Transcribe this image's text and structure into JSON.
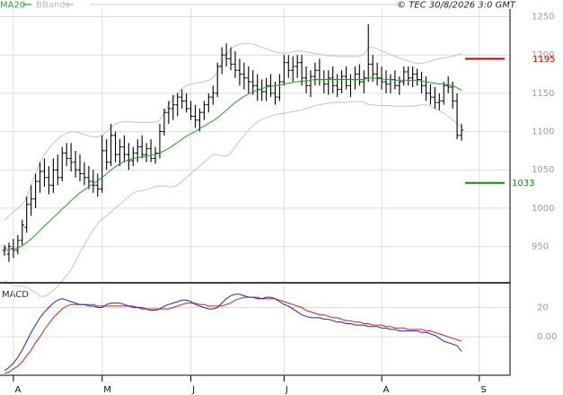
{
  "chart_data": [
    {
      "type": "ohlc",
      "legend": [
        {
          "name": "MA20",
          "color": "#2aa52a"
        },
        {
          "name": "BBands",
          "color": "#b8b8b8"
        }
      ],
      "copyright": "© TEC 30/8/2026 3:0 GMT",
      "ylim": [
        905,
        1260
      ],
      "y_ticks": [
        950,
        1000,
        1050,
        1100,
        1150,
        1200,
        1250
      ],
      "y_tick_labels": [
        "950",
        "1000",
        "1050",
        "1100",
        "1150",
        "1200",
        "1250"
      ],
      "x_ticks": [
        {
          "label": "A",
          "index": 1
        },
        {
          "label": "M",
          "index": 21
        },
        {
          "label": "J",
          "index": 41
        },
        {
          "label": "J",
          "index": 62
        },
        {
          "label": "A",
          "index": 84
        },
        {
          "label": "S",
          "index": 106
        }
      ],
      "levels": [
        {
          "label": "1195",
          "value": 1195,
          "color": "#cc0000"
        },
        {
          "label": "1033",
          "value": 1033,
          "color": "#118811"
        }
      ],
      "price_ohlc": [
        [
          945,
          952,
          938,
          948
        ],
        [
          940,
          955,
          930,
          950
        ],
        [
          948,
          960,
          935,
          945
        ],
        [
          945,
          965,
          940,
          958
        ],
        [
          958,
          985,
          952,
          978
        ],
        [
          975,
          1015,
          968,
          1005
        ],
        [
          1005,
          1030,
          990,
          1012
        ],
        [
          1012,
          1045,
          1000,
          1035
        ],
        [
          1035,
          1060,
          1020,
          1048
        ],
        [
          1048,
          1065,
          1028,
          1040
        ],
        [
          1040,
          1055,
          1018,
          1030
        ],
        [
          1030,
          1065,
          1020,
          1050
        ],
        [
          1050,
          1070,
          1030,
          1040
        ],
        [
          1040,
          1080,
          1035,
          1072
        ],
        [
          1072,
          1085,
          1055,
          1065
        ],
        [
          1065,
          1085,
          1048,
          1060
        ],
        [
          1060,
          1075,
          1040,
          1050
        ],
        [
          1050,
          1070,
          1035,
          1045
        ],
        [
          1045,
          1060,
          1030,
          1040
        ],
        [
          1040,
          1055,
          1025,
          1035
        ],
        [
          1035,
          1050,
          1020,
          1030
        ],
        [
          1030,
          1045,
          1015,
          1025
        ],
        [
          1025,
          1095,
          1020,
          1075
        ],
        [
          1075,
          1090,
          1050,
          1060
        ],
        [
          1060,
          1110,
          1055,
          1095
        ],
        [
          1095,
          1100,
          1060,
          1070
        ],
        [
          1070,
          1090,
          1055,
          1080
        ],
        [
          1080,
          1095,
          1060,
          1070
        ],
        [
          1070,
          1085,
          1050,
          1062
        ],
        [
          1062,
          1080,
          1055,
          1072
        ],
        [
          1072,
          1090,
          1060,
          1080
        ],
        [
          1080,
          1095,
          1065,
          1070
        ],
        [
          1070,
          1085,
          1060,
          1078
        ],
        [
          1078,
          1090,
          1060,
          1065
        ],
        [
          1065,
          1080,
          1058,
          1072
        ],
        [
          1072,
          1110,
          1065,
          1100
        ],
        [
          1100,
          1130,
          1095,
          1125
        ],
        [
          1125,
          1140,
          1110,
          1130
        ],
        [
          1130,
          1148,
          1115,
          1135
        ],
        [
          1135,
          1150,
          1120,
          1145
        ],
        [
          1145,
          1155,
          1130,
          1140
        ],
        [
          1140,
          1150,
          1125,
          1130
        ],
        [
          1130,
          1140,
          1115,
          1120
        ],
        [
          1120,
          1135,
          1105,
          1115
        ],
        [
          1115,
          1130,
          1100,
          1125
        ],
        [
          1125,
          1140,
          1115,
          1135
        ],
        [
          1135,
          1150,
          1125,
          1145
        ],
        [
          1145,
          1160,
          1135,
          1150
        ],
        [
          1150,
          1190,
          1145,
          1185
        ],
        [
          1185,
          1210,
          1175,
          1200
        ],
        [
          1200,
          1215,
          1185,
          1195
        ],
        [
          1195,
          1210,
          1180,
          1188
        ],
        [
          1188,
          1205,
          1170,
          1180
        ],
        [
          1180,
          1195,
          1160,
          1175
        ],
        [
          1175,
          1190,
          1155,
          1170
        ],
        [
          1170,
          1185,
          1150,
          1165
        ],
        [
          1165,
          1180,
          1148,
          1160
        ],
        [
          1160,
          1175,
          1140,
          1155
        ],
        [
          1155,
          1168,
          1140,
          1152
        ],
        [
          1152,
          1170,
          1140,
          1160
        ],
        [
          1160,
          1175,
          1145,
          1150
        ],
        [
          1150,
          1165,
          1135,
          1145
        ],
        [
          1145,
          1175,
          1140,
          1165
        ],
        [
          1165,
          1200,
          1160,
          1190
        ],
        [
          1190,
          1200,
          1170,
          1180
        ],
        [
          1180,
          1198,
          1165,
          1185
        ],
        [
          1185,
          1200,
          1170,
          1190
        ],
        [
          1190,
          1200,
          1160,
          1170
        ],
        [
          1170,
          1185,
          1150,
          1160
        ],
        [
          1160,
          1180,
          1145,
          1172
        ],
        [
          1172,
          1190,
          1160,
          1180
        ],
        [
          1180,
          1195,
          1160,
          1168
        ],
        [
          1168,
          1180,
          1150,
          1162
        ],
        [
          1162,
          1180,
          1148,
          1170
        ],
        [
          1170,
          1185,
          1150,
          1160
        ],
        [
          1160,
          1175,
          1145,
          1155
        ],
        [
          1155,
          1180,
          1150,
          1172
        ],
        [
          1172,
          1185,
          1155,
          1160
        ],
        [
          1160,
          1175,
          1145,
          1168
        ],
        [
          1168,
          1185,
          1155,
          1175
        ],
        [
          1175,
          1188,
          1160,
          1165
        ],
        [
          1165,
          1180,
          1150,
          1170
        ],
        [
          1170,
          1240,
          1165,
          1188
        ],
        [
          1188,
          1200,
          1165,
          1175
        ],
        [
          1175,
          1190,
          1160,
          1170
        ],
        [
          1170,
          1185,
          1155,
          1165
        ],
        [
          1165,
          1180,
          1150,
          1162
        ],
        [
          1162,
          1175,
          1150,
          1168
        ],
        [
          1168,
          1180,
          1155,
          1160
        ],
        [
          1160,
          1172,
          1148,
          1165
        ],
        [
          1165,
          1185,
          1160,
          1178
        ],
        [
          1178,
          1185,
          1160,
          1170
        ],
        [
          1170,
          1185,
          1158,
          1175
        ],
        [
          1175,
          1182,
          1160,
          1168
        ],
        [
          1168,
          1178,
          1150,
          1160
        ],
        [
          1160,
          1172,
          1140,
          1150
        ],
        [
          1150,
          1162,
          1135,
          1145
        ],
        [
          1145,
          1158,
          1130,
          1138
        ],
        [
          1138,
          1150,
          1128,
          1140
        ],
        [
          1140,
          1165,
          1135,
          1160
        ],
        [
          1160,
          1172,
          1150,
          1158
        ],
        [
          1158,
          1165,
          1130,
          1140
        ],
        [
          1140,
          1150,
          1090,
          1095
        ],
        [
          1095,
          1110,
          1088,
          1102
        ]
      ],
      "ma20": [
        945,
        946,
        947,
        948,
        951,
        955,
        960,
        965,
        971,
        977,
        982,
        988,
        993,
        999,
        1004,
        1010,
        1015,
        1020,
        1024,
        1028,
        1032,
        1036,
        1040,
        1045,
        1050,
        1054,
        1058,
        1061,
        1063,
        1065,
        1066,
        1067,
        1068,
        1069,
        1070,
        1072,
        1075,
        1078,
        1082,
        1086,
        1090,
        1094,
        1097,
        1100,
        1104,
        1107,
        1111,
        1114,
        1118,
        1123,
        1128,
        1133,
        1138,
        1142,
        1146,
        1149,
        1152,
        1154,
        1156,
        1158,
        1159,
        1160,
        1161,
        1162,
        1163,
        1164,
        1165,
        1166,
        1166,
        1167,
        1168,
        1168,
        1168,
        1168,
        1168,
        1168,
        1168,
        1168,
        1168,
        1168,
        1168,
        1168,
        1170,
        1170,
        1169,
        1169,
        1168,
        1168,
        1167,
        1167,
        1167,
        1167,
        1167,
        1167,
        1166,
        1165,
        1164,
        1163,
        1162,
        1162,
        1161,
        1160,
        1157,
        1154
      ],
      "bb_upper": [
        985,
        990,
        995,
        1000,
        1005,
        1015,
        1030,
        1045,
        1060,
        1070,
        1078,
        1085,
        1090,
        1095,
        1098,
        1100,
        1100,
        1098,
        1096,
        1094,
        1093,
        1093,
        1095,
        1100,
        1105,
        1110,
        1112,
        1113,
        1113,
        1112,
        1112,
        1112,
        1112,
        1112,
        1112,
        1115,
        1125,
        1135,
        1143,
        1150,
        1156,
        1160,
        1162,
        1163,
        1164,
        1165,
        1167,
        1170,
        1178,
        1190,
        1200,
        1208,
        1212,
        1214,
        1215,
        1215,
        1214,
        1212,
        1210,
        1208,
        1206,
        1204,
        1203,
        1202,
        1203,
        1204,
        1205,
        1205,
        1204,
        1203,
        1202,
        1201,
        1200,
        1199,
        1199,
        1198,
        1198,
        1198,
        1198,
        1198,
        1198,
        1200,
        1210,
        1210,
        1208,
        1205,
        1203,
        1200,
        1198,
        1196,
        1194,
        1192,
        1190,
        1189,
        1189,
        1190,
        1192,
        1194,
        1195,
        1196,
        1197,
        1198,
        1200,
        1202
      ],
      "bb_lower": [
        905,
        902,
        900,
        898,
        898,
        897,
        893,
        890,
        885,
        885,
        888,
        893,
        898,
        905,
        912,
        920,
        930,
        942,
        952,
        962,
        972,
        980,
        986,
        990,
        995,
        1000,
        1005,
        1010,
        1015,
        1020,
        1022,
        1023,
        1024,
        1026,
        1028,
        1029,
        1029,
        1028,
        1028,
        1030,
        1035,
        1040,
        1045,
        1050,
        1055,
        1060,
        1065,
        1070,
        1070,
        1068,
        1068,
        1072,
        1080,
        1088,
        1095,
        1102,
        1108,
        1112,
        1116,
        1118,
        1120,
        1122,
        1123,
        1124,
        1125,
        1126,
        1127,
        1128,
        1130,
        1132,
        1134,
        1135,
        1136,
        1137,
        1138,
        1138,
        1138,
        1138,
        1139,
        1139,
        1139,
        1139,
        1135,
        1135,
        1134,
        1134,
        1134,
        1134,
        1133,
        1133,
        1133,
        1133,
        1133,
        1134,
        1135,
        1135,
        1133,
        1130,
        1127,
        1124,
        1120,
        1115,
        1110,
        1105
      ]
    },
    {
      "type": "line",
      "title": "MACD",
      "ylim": [
        -25,
        35
      ],
      "y_ticks": [
        0,
        20
      ],
      "y_tick_labels": [
        "0.00",
        "20"
      ],
      "series": [
        {
          "color": "#2222cc",
          "values": [
            -23,
            -21,
            -18,
            -14,
            -9,
            -3,
            3,
            8,
            13,
            17,
            20,
            23,
            25,
            26,
            25,
            24,
            23,
            22,
            22,
            21,
            21,
            20,
            20,
            22,
            23,
            23,
            23,
            22,
            21,
            20,
            20,
            19,
            19,
            18,
            18,
            19,
            21,
            22,
            23,
            24,
            25,
            25,
            24,
            22,
            21,
            20,
            19,
            19,
            20,
            23,
            26,
            28,
            29,
            29,
            28,
            27,
            27,
            26,
            26,
            27,
            27,
            26,
            24,
            22,
            21,
            19,
            17,
            15,
            14,
            13,
            13,
            13,
            12,
            12,
            11,
            10,
            10,
            9,
            9,
            8,
            8,
            8,
            7,
            7,
            7,
            6,
            6,
            5,
            5,
            4,
            4,
            4,
            4,
            4,
            3,
            3,
            2,
            1,
            -1,
            -3,
            -4,
            -5,
            -6,
            -10
          ]
        },
        {
          "color": "#cc2222",
          "values": [
            -25,
            -24,
            -22,
            -20,
            -17,
            -13,
            -9,
            -4,
            0,
            5,
            9,
            13,
            16,
            19,
            21,
            22,
            22,
            22,
            22,
            22,
            22,
            21,
            21,
            21,
            21,
            21,
            21,
            21,
            21,
            21,
            20,
            20,
            19,
            19,
            19,
            19,
            19,
            19,
            20,
            21,
            22,
            23,
            23,
            23,
            22,
            22,
            21,
            21,
            21,
            21,
            22,
            23,
            25,
            26,
            27,
            27,
            27,
            27,
            26,
            26,
            26,
            26,
            25,
            24,
            23,
            22,
            21,
            20,
            18,
            17,
            16,
            15,
            15,
            14,
            13,
            13,
            12,
            11,
            11,
            10,
            10,
            9,
            9,
            8,
            8,
            8,
            7,
            7,
            6,
            6,
            6,
            5,
            5,
            5,
            5,
            4,
            4,
            3,
            2,
            1,
            0,
            -1,
            -2,
            -3
          ]
        }
      ]
    }
  ]
}
